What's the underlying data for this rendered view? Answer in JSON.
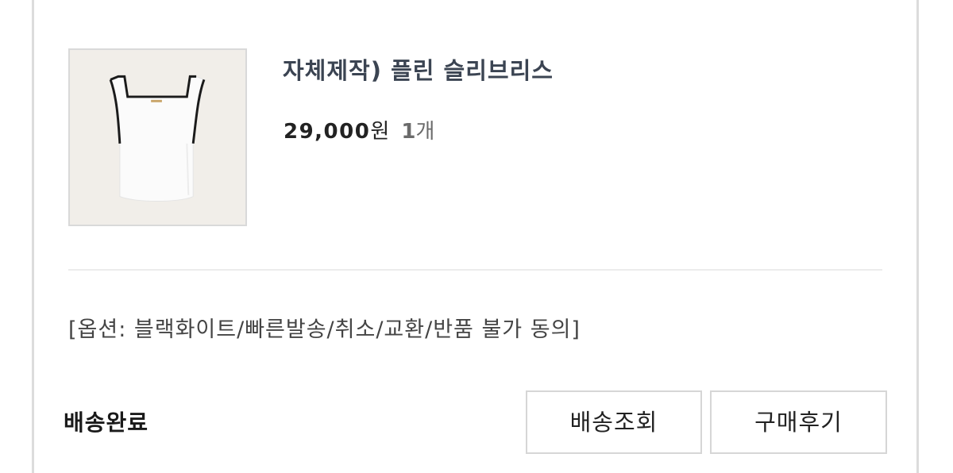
{
  "product": {
    "name": "자체제작) 플린 슬리브리스",
    "price": "29,000",
    "price_unit": "원",
    "quantity_num": "1",
    "quantity_unit": "개",
    "image_icon": "sleeveless-top-image"
  },
  "option": {
    "text": "[옵션: 블랙화이트/빠른발송/취소/교환/반품 불가 동의]"
  },
  "order": {
    "status": "배송완료"
  },
  "actions": {
    "track_label": "배송조회",
    "review_label": "구매후기"
  },
  "colors": {
    "title": "#3b4452",
    "border": "#d6d6d6",
    "thumb_bg": "#f1eee9"
  }
}
